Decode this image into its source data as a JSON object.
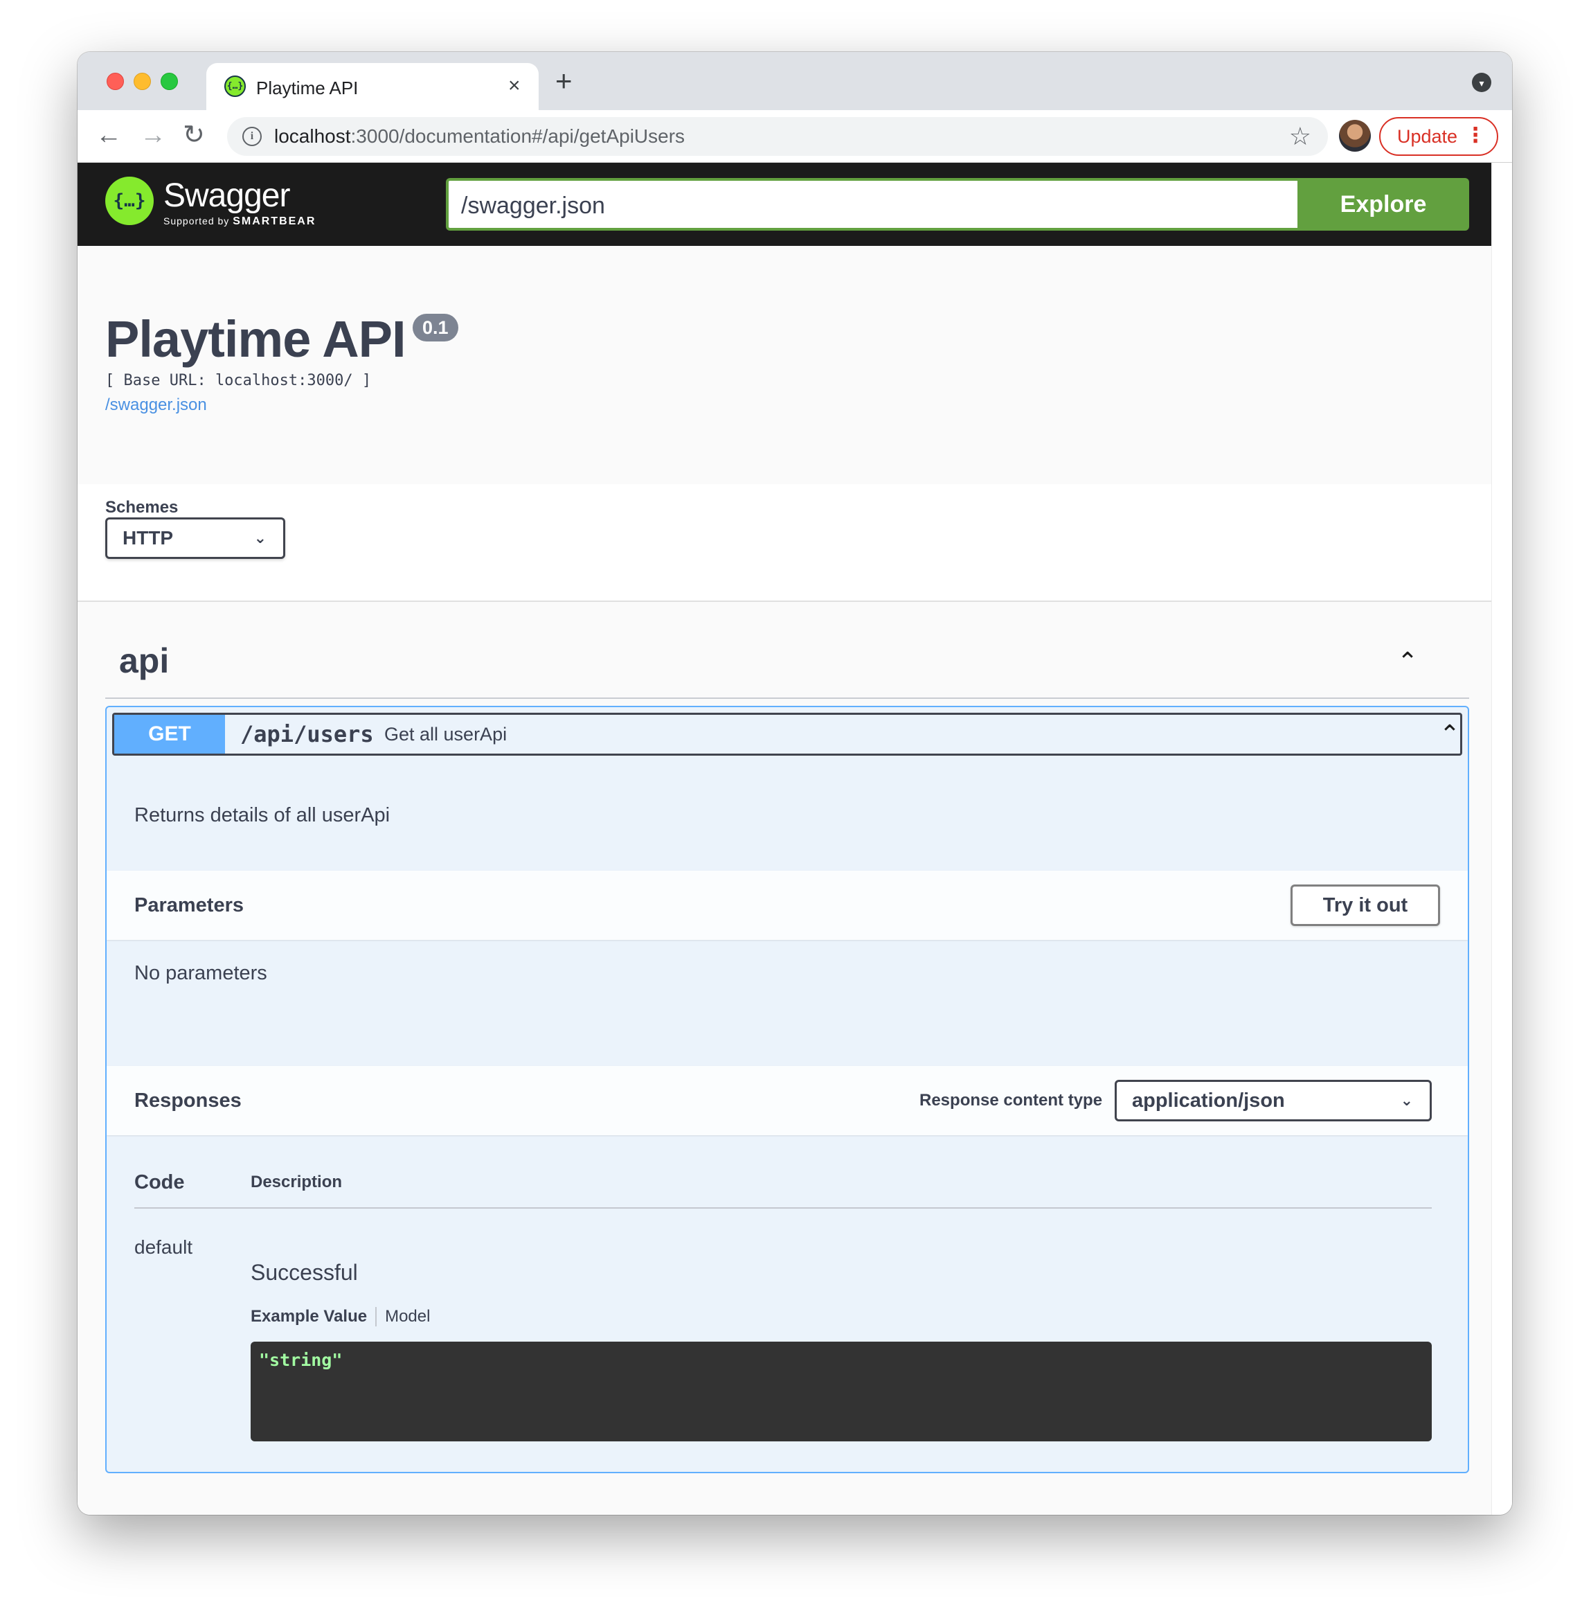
{
  "browser": {
    "tab_title": "Playtime API",
    "tab_close": "×",
    "new_tab": "+",
    "url_host": "localhost",
    "url_rest": ":3000/documentation#/api/getApiUsers",
    "update_label": "Update",
    "update_menu": "⋮",
    "back_icon": "←",
    "forward_icon": "→",
    "reload_icon": "↻",
    "star_icon": "☆",
    "tab_menu_icon": "▾"
  },
  "swagger_topbar": {
    "logo_glyph": "{…}",
    "logo_text": "Swagger",
    "logo_sub_prefix": "Supported by",
    "logo_sub_brand": "SMARTBEAR",
    "url_value": "/swagger.json",
    "explore_label": "Explore",
    "brand_color": "#85ea2d",
    "explore_color": "#62a03f"
  },
  "info": {
    "title": "Playtime API",
    "version": "0.1",
    "base_url": "[ Base URL: localhost:3000/ ]",
    "spec_link": "/swagger.json"
  },
  "schemes": {
    "label": "Schemes",
    "selected": "HTTP"
  },
  "tag": {
    "name": "api",
    "collapse_icon": "chevron-up-icon"
  },
  "operation": {
    "method": "GET",
    "method_color": "#61affe",
    "path": "/api/users",
    "summary": "Get all userApi",
    "description": "Returns details of all userApi",
    "parameters_title": "Parameters",
    "try_label": "Try it out",
    "no_parameters": "No parameters",
    "responses_title": "Responses",
    "response_content_type_label": "Response content type",
    "response_content_type": "application/json",
    "columns": {
      "code": "Code",
      "description": "Description"
    },
    "responses": [
      {
        "code": "default",
        "description": "Successful",
        "tabs": [
          "Example Value",
          "Model"
        ],
        "example": "\"string\""
      }
    ]
  }
}
